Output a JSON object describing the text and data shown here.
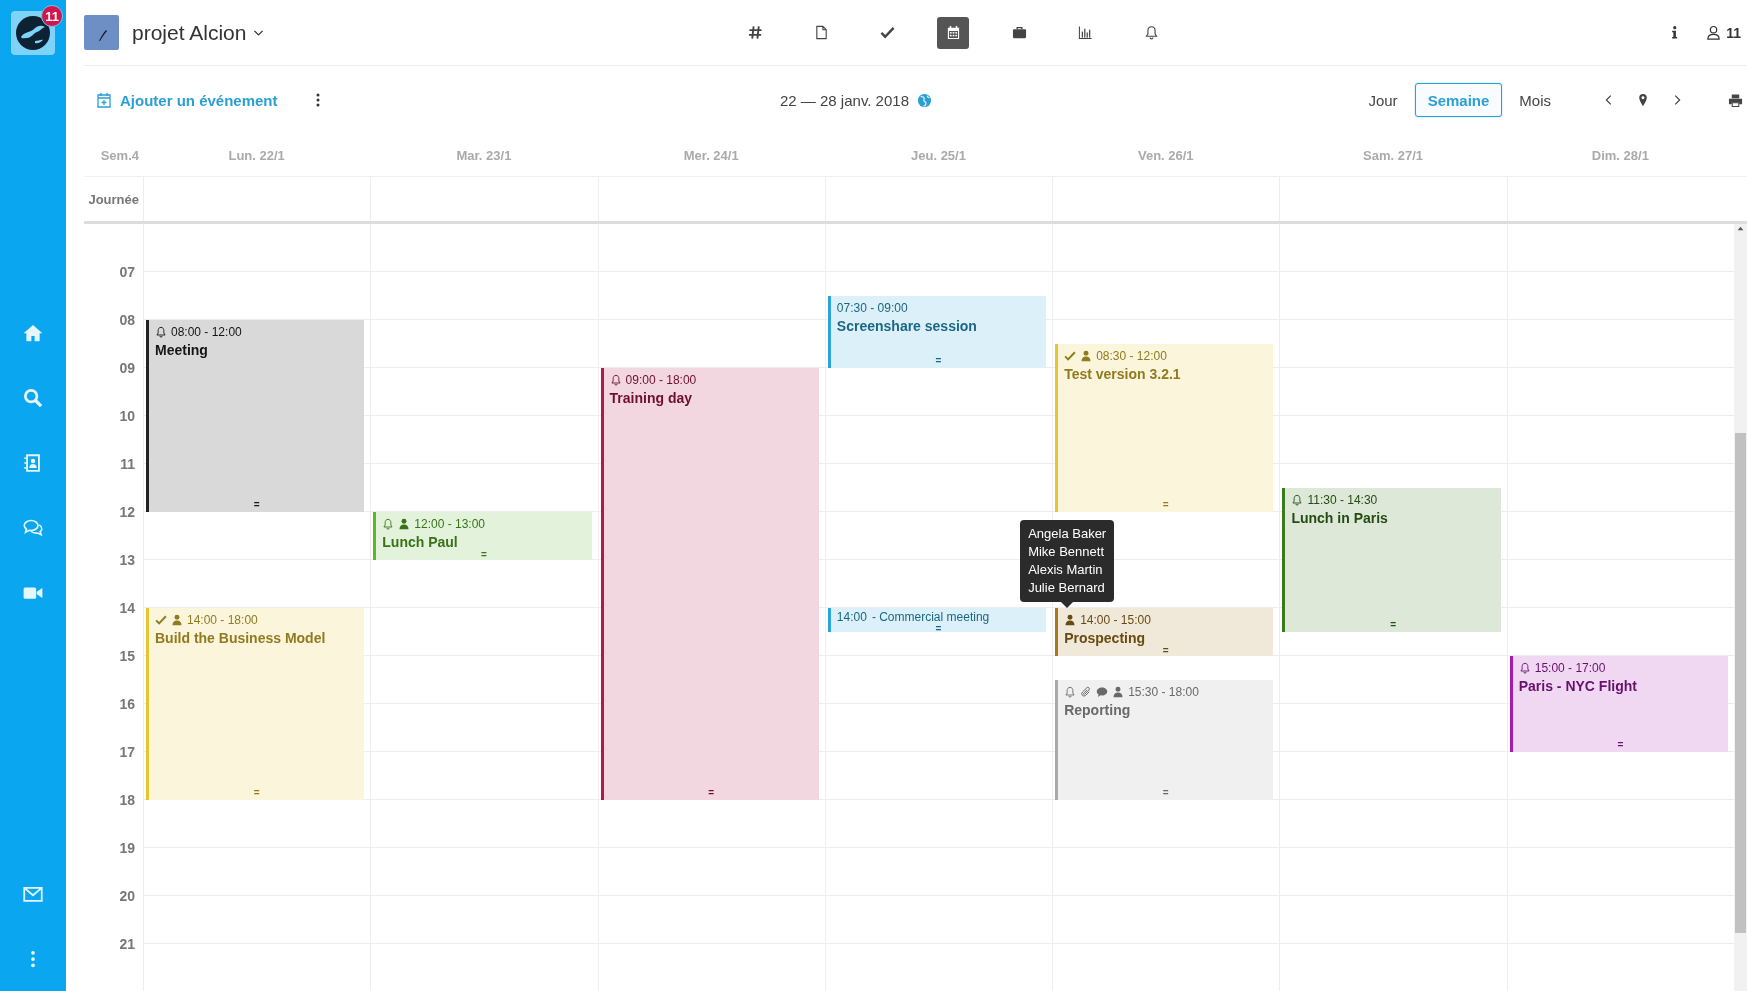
{
  "sidebar": {
    "badge": "11"
  },
  "header": {
    "project": "projet Alcion",
    "nav": [
      {
        "selected": false
      },
      {
        "selected": false
      },
      {
        "selected": false
      },
      {
        "selected": true
      },
      {
        "selected": false
      },
      {
        "selected": false
      },
      {
        "selected": false
      }
    ],
    "users_count": "11"
  },
  "toolbar": {
    "add_event": "Ajouter un événement",
    "date_range": "22 — 28 janv. 2018",
    "views": [
      {
        "label": "Jour",
        "selected": false
      },
      {
        "label": "Semaine",
        "selected": true
      },
      {
        "label": "Mois",
        "selected": false
      }
    ]
  },
  "calendar": {
    "week": "Sem.4",
    "all_day_label": "Journée",
    "hours": [
      "07",
      "08",
      "09",
      "10",
      "11",
      "12",
      "13",
      "14",
      "15",
      "16",
      "17",
      "18",
      "19",
      "20",
      "21"
    ],
    "days": [
      {
        "label": "Lun. 22/1",
        "events": [
          {
            "kind": "block",
            "time": "08:00 - 12:00",
            "title": "Meeting",
            "color": "#222222",
            "reminder": true,
            "done": false,
            "attachment": false,
            "comment": false,
            "attendees": false,
            "handle": "="
          },
          {
            "kind": "block",
            "time": "14:00 - 18:00",
            "title": "Build the Business Model",
            "color": "#e8c632",
            "reminder": false,
            "done": true,
            "attachment": false,
            "comment": false,
            "attendees": true,
            "handle": "="
          }
        ]
      },
      {
        "label": "Mar. 23/1",
        "events": [
          {
            "kind": "block",
            "time": "12:00 - 13:00",
            "title": "Lunch Paul",
            "color": "#5cb82a",
            "reminder": true,
            "done": false,
            "attachment": false,
            "comment": false,
            "attendees": true,
            "handle": "="
          }
        ]
      },
      {
        "label": "Mer. 24/1",
        "events": [
          {
            "kind": "block",
            "time": "09:00 - 18:00",
            "title": "Training day",
            "color": "#b5164b",
            "reminder": true,
            "done": false,
            "attachment": false,
            "comment": false,
            "attendees": false,
            "handle": "="
          }
        ]
      },
      {
        "label": "Jeu. 25/1",
        "events": [
          {
            "kind": "block",
            "time": "07:30 - 09:00",
            "title": "Screenshare session",
            "color": "#2ba4d6",
            "reminder": false,
            "done": false,
            "attachment": false,
            "comment": false,
            "attendees": false,
            "handle": "="
          },
          {
            "kind": "compact",
            "time": "14:00",
            "title": "- Commercial meeting",
            "color": "#2ba4d6",
            "reminder": false,
            "done": false,
            "attachment": false,
            "comment": false,
            "attendees": false,
            "handle": "="
          }
        ]
      },
      {
        "label": "Ven. 26/1",
        "events": [
          {
            "kind": "block",
            "time": "08:30 - 12:00",
            "title": "Test version 3.2.1",
            "color": "#e8c632",
            "reminder": false,
            "done": true,
            "attachment": false,
            "comment": false,
            "attendees": true,
            "handle": "="
          },
          {
            "kind": "block",
            "time": "14:00 - 15:00",
            "title": "Prospecting",
            "color": "#a8781f",
            "reminder": false,
            "done": false,
            "attachment": false,
            "comment": false,
            "attendees": true,
            "handle": "=",
            "tooltip": [
              "Angela Baker",
              "Mike Bennett",
              "Alexis Martin",
              "Julie Bernard"
            ]
          },
          {
            "kind": "block",
            "time": "15:30 - 18:00",
            "title": "Reporting",
            "color": "#a9a9a9",
            "reminder": true,
            "done": false,
            "attachment": true,
            "comment": true,
            "attendees": true,
            "handle": "="
          }
        ]
      },
      {
        "label": "Sam. 27/1",
        "events": [
          {
            "kind": "block",
            "time": "11:30 - 14:30",
            "title": "Lunch in Paris",
            "color": "#3a7a1c",
            "reminder": true,
            "done": false,
            "attachment": false,
            "comment": false,
            "attendees": false,
            "handle": "="
          }
        ]
      },
      {
        "label": "Dim. 28/1",
        "events": [
          {
            "kind": "block",
            "time": "15:00 - 17:00",
            "title": "Paris - NYC Flight",
            "color": "#a61cb0",
            "reminder": true,
            "done": false,
            "attachment": false,
            "comment": false,
            "attendees": false,
            "handle": "="
          }
        ]
      }
    ]
  }
}
